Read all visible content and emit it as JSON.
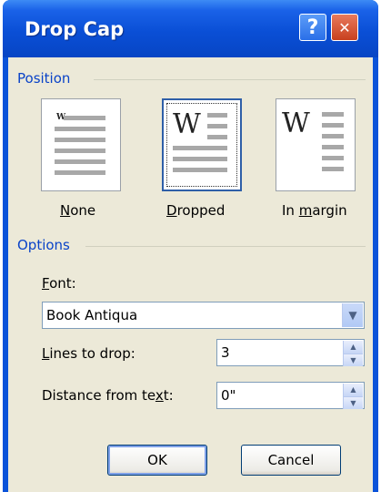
{
  "window": {
    "title": "Drop Cap"
  },
  "titlebar_buttons": {
    "help_label": "?",
    "close_label": "✕"
  },
  "position": {
    "group_label": "Position",
    "options": [
      {
        "label": "None",
        "selected": false
      },
      {
        "label": "Dropped",
        "selected": true
      },
      {
        "label": "In margin",
        "selected": false
      }
    ]
  },
  "options": {
    "group_label": "Options",
    "font": {
      "label": "Font:",
      "value": "Book Antiqua"
    },
    "lines_to_drop": {
      "label": "Lines to drop:",
      "value": "3"
    },
    "distance": {
      "label": "Distance from text:",
      "value": "0\""
    }
  },
  "buttons": {
    "ok": "OK",
    "cancel": "Cancel"
  },
  "icons": {
    "help": "help-icon",
    "close": "close-icon",
    "dropdown": "chevron-down-icon",
    "spin_up": "spin-up-icon",
    "spin_down": "spin-down-icon"
  }
}
